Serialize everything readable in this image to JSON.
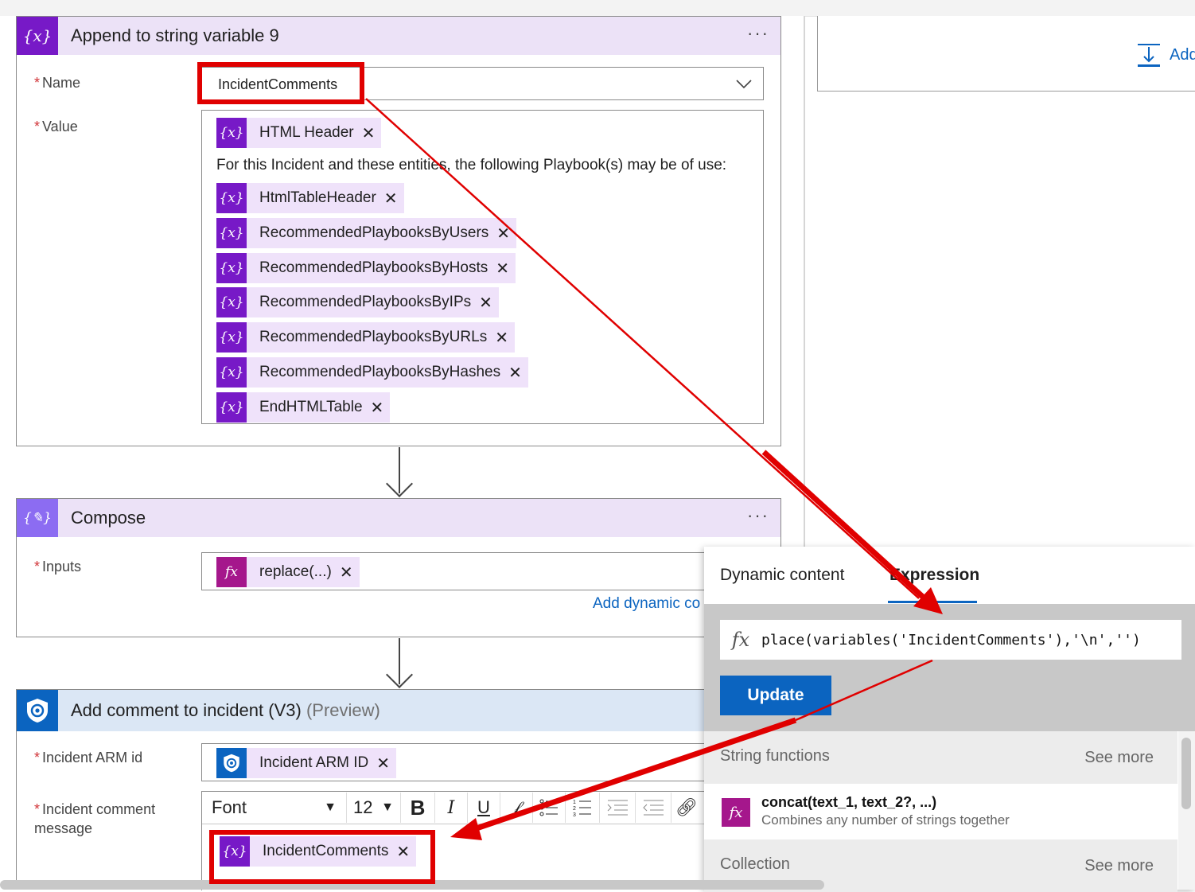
{
  "append_card": {
    "title": "Append to string variable 9",
    "more": "···",
    "name_label": "Name",
    "name_value": "IncidentComments",
    "value_label": "Value",
    "required_mark": "*",
    "tokens": [
      {
        "label": "HTML Header"
      },
      {
        "label": "HtmlTableHeader"
      },
      {
        "label": "RecommendedPlaybooksByUsers"
      },
      {
        "label": "RecommendedPlaybooksByHosts"
      },
      {
        "label": "RecommendedPlaybooksByIPs"
      },
      {
        "label": "RecommendedPlaybooksByURLs"
      },
      {
        "label": "RecommendedPlaybooksByHashes"
      },
      {
        "label": "EndHTMLTable"
      }
    ],
    "value_text": "For this Incident and these entities, the following Playbook(s) may be of use:"
  },
  "compose_card": {
    "title": "Compose",
    "more": "···",
    "inputs_label": "Inputs",
    "token": "replace(...)",
    "add_dynamic": "Add dynamic co"
  },
  "comment_card": {
    "title": "Add comment to incident (V3)",
    "title_sub": "(Preview)",
    "arm_label": "Incident ARM id",
    "arm_token": "Incident ARM ID",
    "msg_label_1": "Incident comment",
    "msg_label_2": "message",
    "toolbar": {
      "font": "Font",
      "size": "12",
      "bold": "B",
      "italic": "I",
      "underline": "U"
    },
    "msg_token": "IncidentComments"
  },
  "right_panel": {
    "add_label": "Add"
  },
  "expression_panel": {
    "tab_dynamic": "Dynamic content",
    "tab_expression": "Expression",
    "expression_text": "place(variables('IncidentComments'),'\\n','')",
    "update_label": "Update",
    "sections": [
      {
        "name": "String functions",
        "more": "See more"
      },
      {
        "name": "Collection",
        "more": "See more"
      }
    ],
    "function": {
      "name": "concat(text_1, text_2?, ...)",
      "description": "Combines any number of strings together"
    }
  },
  "colors": {
    "variable_icon": "#7719c7",
    "expression_icon": "#a5178c",
    "sentinel_icon": "#0b64c0",
    "token_bg": "#efe2fa",
    "annotation_red": "#e00000",
    "accent_blue": "#0b64c0"
  }
}
